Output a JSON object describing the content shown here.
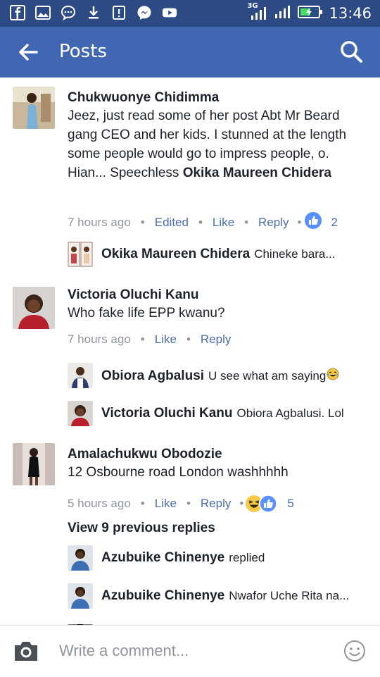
{
  "status_bar": {
    "signal_label": "3G",
    "time": "13:46"
  },
  "header": {
    "title": "Posts"
  },
  "comments": [
    {
      "author": "Chukwuonye Chidimma",
      "text": "Jeez, just read some of her post Abt Mr Beard gang CEO and her kids. I stunned at the length some people would go to impress people, o. Hian... Speechless",
      "mention": "Okika Maureen Chidera",
      "time": "7 hours ago",
      "edited": "Edited",
      "like": "Like",
      "reply": "Reply",
      "reaction_count": "2",
      "replies": [
        {
          "author": "Okika Maureen Chidera",
          "text": "Chineke bara..."
        }
      ]
    },
    {
      "author": "Victoria Oluchi Kanu",
      "text": "Who fake life EPP kwanu?",
      "time": "7 hours ago",
      "like": "Like",
      "reply": "Reply",
      "replies": [
        {
          "author": "Obiora Agbalusi",
          "text": "U see what am saying"
        },
        {
          "author": "Victoria Oluchi Kanu",
          "text": "Obiora Agbalusi. Lol"
        }
      ]
    },
    {
      "author": "Amalachukwu Obodozie",
      "text": "12 Osbourne road London washhhhh",
      "time": "5 hours ago",
      "like": "Like",
      "reply": "Reply",
      "reaction_count": "5",
      "view_previous": "View 9 previous replies",
      "replies": [
        {
          "author": "Azubuike Chinenye",
          "text": "replied"
        },
        {
          "author": "Azubuike Chinenye",
          "text": "Nwafor Uche Rita na..."
        }
      ]
    }
  ],
  "composer": {
    "placeholder": "Write a comment..."
  },
  "colors": {
    "brand_blue": "#4267b2",
    "status_blue": "#2c4a84",
    "link": "#4b6ea9",
    "meta_gray": "#90949c"
  }
}
